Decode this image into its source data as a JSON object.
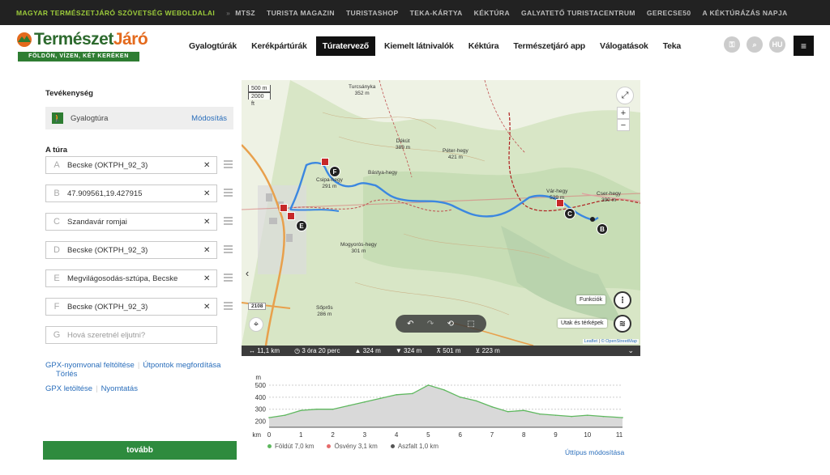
{
  "topbar": {
    "items": [
      "Magyar Természetjáró Szövetség weboldalai",
      "MTSZ",
      "Turista Magazin",
      "Turistashop",
      "TEKA-kártya",
      "Kéktúra",
      "Galyatető Turistacentrum",
      "Gerecse50",
      "A Kéktúrázás Napja"
    ]
  },
  "header": {
    "logo_word_a": "Természet",
    "logo_word_b": "Járó",
    "logo_tagline": "FÖLDÖN, VÍZEN, KÉT KERÉKEN",
    "nav": [
      "Gyalogtúrák",
      "Kerékpártúrák",
      "Túratervező",
      "Kiemelt látnivalók",
      "Kéktúra",
      "Természetjáró app",
      "Válogatások",
      "Teka"
    ],
    "active_nav": "Túratervező",
    "lang": "HU",
    "menu_icon": "hamburger-icon"
  },
  "planner": {
    "activity_title": "Tevékenység",
    "activity": "Gyalogtúra",
    "activity_edit": "Módosítás",
    "tour_title": "A túra",
    "waypoints": [
      {
        "letter": "A",
        "value": "Becske (OKTPH_92_3)"
      },
      {
        "letter": "B",
        "value": "47.909561,19.427915"
      },
      {
        "letter": "C",
        "value": "Szandavár romjai"
      },
      {
        "letter": "D",
        "value": "Becske (OKTPH_92_3)"
      },
      {
        "letter": "E",
        "value": "Megvilágosodás-sztúpa, Becske"
      },
      {
        "letter": "F",
        "value": "Becske (OKTPH_92_3)"
      }
    ],
    "new_waypoint": {
      "letter": "G",
      "placeholder": "Hová szeretnél eljutni?"
    },
    "links": {
      "gpx_upload": "GPX-nyomvonal feltöltése",
      "reverse": "Útpontok megfordítása",
      "delete": "Törlés",
      "gpx_download": "GPX letöltése",
      "print": "Nyomtatás"
    },
    "next_button": "tovább"
  },
  "map": {
    "scale_m": "500 m",
    "scale_ft": "2000 ft",
    "zoom_in": "+",
    "zoom_out": "−",
    "functions_label": "Funkciók",
    "layers_label": "Utak és térképek",
    "attribution_a": "Leaflet",
    "attribution_b": "© OpenStreetMap",
    "road_number": "2108",
    "places": [
      {
        "name": "Turcsányka",
        "elev": "352 m"
      },
      {
        "name": "Dékút",
        "elev": "389 m"
      },
      {
        "name": "Péter-hegy",
        "elev": "421 m"
      },
      {
        "name": "Csipa-hegy",
        "elev": "291 m"
      },
      {
        "name": "Bástya-hegy",
        "elev": ""
      },
      {
        "name": "Vár-hegy",
        "elev": "529 m"
      },
      {
        "name": "Cser-hegy",
        "elev": "390 m"
      },
      {
        "name": "Mogyorós-hegy",
        "elev": "301 m"
      },
      {
        "name": "Sőprős",
        "elev": "286 m"
      }
    ],
    "markers": [
      "B",
      "C",
      "E",
      "F"
    ]
  },
  "stats": {
    "distance": "11,1 km",
    "duration": "3 óra 20 perc",
    "ascent": "324 m",
    "descent": "324 m",
    "max_elev": "501 m",
    "min_elev": "223 m"
  },
  "chart_data": {
    "type": "area",
    "ylabel": "m",
    "xlabel": "km",
    "yticks": [
      200,
      300,
      400,
      500
    ],
    "xticks": [
      0,
      1,
      2,
      3,
      4,
      5,
      6,
      7,
      8,
      9,
      10,
      11
    ],
    "ylim": [
      150,
      540
    ],
    "xlim": [
      0,
      11.1
    ],
    "x": [
      0,
      0.5,
      1,
      1.5,
      2,
      2.5,
      3,
      3.5,
      4,
      4.5,
      5,
      5.5,
      6,
      6.5,
      7,
      7.5,
      8,
      8.5,
      9,
      9.5,
      10,
      10.5,
      11.1
    ],
    "y": [
      230,
      250,
      290,
      300,
      300,
      330,
      360,
      390,
      420,
      430,
      500,
      460,
      400,
      370,
      320,
      280,
      290,
      260,
      250,
      240,
      250,
      240,
      230
    ],
    "surfaces": [
      {
        "name": "Földút 7,0 km",
        "color": "#5fb85f"
      },
      {
        "name": "Ösvény 3,1 km",
        "color": "#e56b6b"
      },
      {
        "name": "Aszfalt 1,0 km",
        "color": "#555555"
      }
    ],
    "edit_link": "Úttípus módosítása"
  }
}
